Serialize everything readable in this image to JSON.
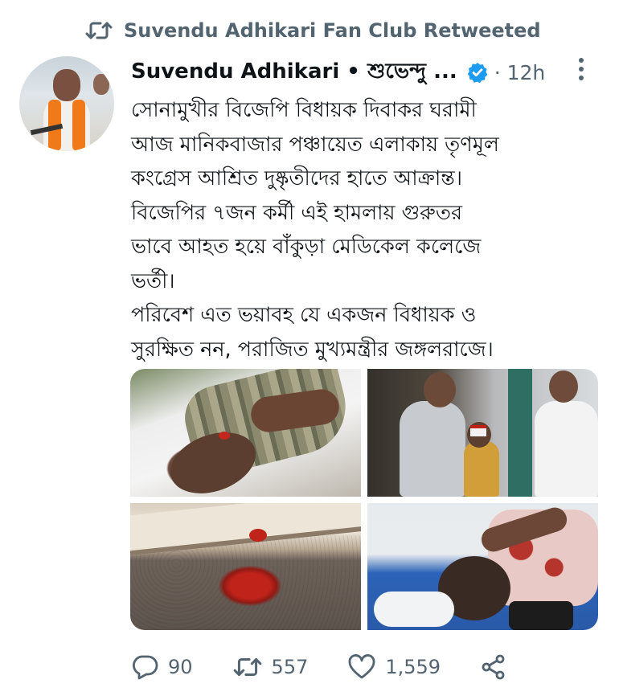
{
  "retweet": {
    "label": "Suvendu Adhikari Fan Club Retweeted"
  },
  "tweet": {
    "author_name": "Suvendu Adhikari • শুভেন্দু ...",
    "time": "· 12h",
    "text_lines": [
      "সোনামুখীর বিজেপি বিধায়ক দিবাকর ঘরামী",
      "আজ মানিকবাজার পঞ্চায়েত এলাকায় তৃণমূল",
      "কংগ্রেস আশ্রিত দুষ্কৃতীদের হাতে আক্রান্ত।",
      "বিজেপির ৭জন কর্মী এই হামলায় গুরুতর",
      "ভাবে আহত হয়ে বাঁকুড়া মেডিকেল কলেজে",
      "ভর্তী।",
      "পরিবেশ এত ভয়াবহ যে একজন বিধায়ক ও",
      "সুরক্ষিত নন, পরাজিত মুখ্যমন্ত্রীর জঙ্গলরাজে।"
    ]
  },
  "actions": {
    "replies": "90",
    "retweets": "557",
    "likes": "1,559"
  },
  "icons": {
    "retweet": "retweet-icon",
    "verified": "verified-badge-icon",
    "more": "more-vertical-icon",
    "reply": "reply-icon",
    "like": "heart-icon",
    "share": "share-icon"
  },
  "colors": {
    "secondary_text": "#536471",
    "verified_blue": "#1d9bf0",
    "primary_text": "#0f1419"
  }
}
